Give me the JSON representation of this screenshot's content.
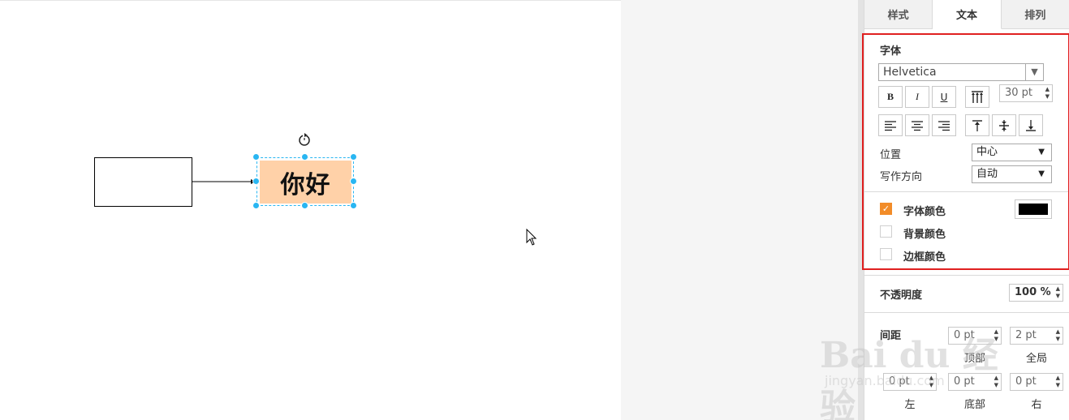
{
  "canvas": {
    "text_shape_label": "你好",
    "text_shape_fill": "#ffd1a8",
    "selection_color": "#29b6f2"
  },
  "panel": {
    "tabs": [
      {
        "label": "样式",
        "active": false
      },
      {
        "label": "文本",
        "active": true
      },
      {
        "label": "排列",
        "active": false
      }
    ],
    "font": {
      "section_label": "字体",
      "family": "Helvetica",
      "bold_label": "B",
      "italic_label": "I",
      "underline_label": "U",
      "size": "30 pt"
    },
    "position": {
      "label": "位置",
      "value": "中心"
    },
    "writing_direction": {
      "label": "写作方向",
      "value": "自动"
    },
    "colors": {
      "font_color": {
        "label": "字体颜色",
        "checked": true,
        "value": "#000000"
      },
      "background_color": {
        "label": "背景颜色",
        "checked": false
      },
      "border_color": {
        "label": "边框颜色",
        "checked": false
      }
    },
    "opacity": {
      "label": "不透明度",
      "value": "100 %"
    },
    "spacing": {
      "label": "间距",
      "top": {
        "label": "顶部",
        "value": "0 pt"
      },
      "global": {
        "label": "全局",
        "value": "2 pt"
      },
      "left": {
        "label": "左",
        "value": "0 pt"
      },
      "bottom": {
        "label": "底部",
        "value": "0 pt"
      },
      "right": {
        "label": "右",
        "value": "0 pt"
      }
    }
  },
  "watermark": {
    "brand": "Bai du 经验",
    "url": "jingyan.baidu.com"
  },
  "colors": {
    "accent": "#f28c28",
    "highlight": "#e02020"
  }
}
